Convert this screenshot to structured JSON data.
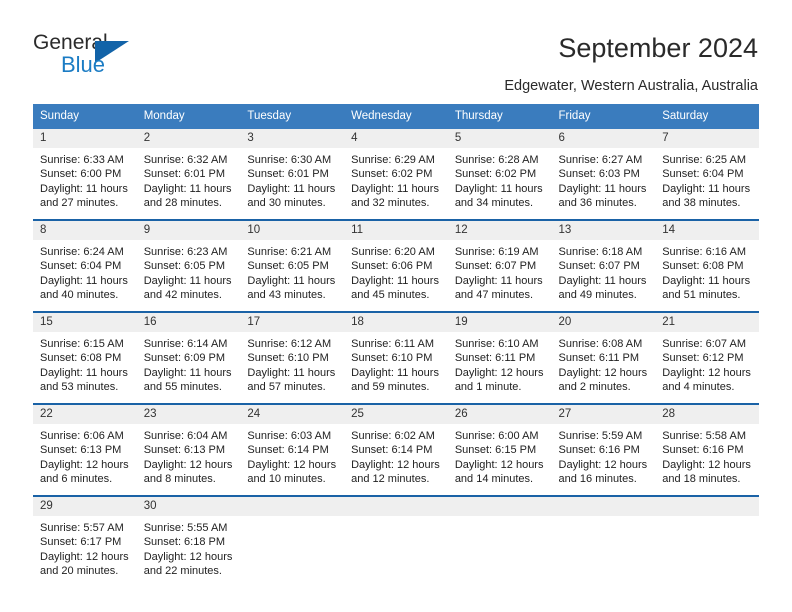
{
  "brand": {
    "name_top": "General",
    "name_bottom": "Blue",
    "accent_color": "#1b7cc4",
    "triangle_color": "#1263a8"
  },
  "header": {
    "title": "September 2024",
    "subtitle": "Edgewater, Western Australia, Australia"
  },
  "calendar": {
    "header_bg": "#3a7cbe",
    "row_divider_color": "#1a62a6",
    "daynum_bg": "#efefef",
    "weekdays": [
      "Sunday",
      "Monday",
      "Tuesday",
      "Wednesday",
      "Thursday",
      "Friday",
      "Saturday"
    ],
    "weeks": [
      [
        {
          "day": "1",
          "sunrise": "Sunrise: 6:33 AM",
          "sunset": "Sunset: 6:00 PM",
          "daylight": "Daylight: 11 hours and 27 minutes."
        },
        {
          "day": "2",
          "sunrise": "Sunrise: 6:32 AM",
          "sunset": "Sunset: 6:01 PM",
          "daylight": "Daylight: 11 hours and 28 minutes."
        },
        {
          "day": "3",
          "sunrise": "Sunrise: 6:30 AM",
          "sunset": "Sunset: 6:01 PM",
          "daylight": "Daylight: 11 hours and 30 minutes."
        },
        {
          "day": "4",
          "sunrise": "Sunrise: 6:29 AM",
          "sunset": "Sunset: 6:02 PM",
          "daylight": "Daylight: 11 hours and 32 minutes."
        },
        {
          "day": "5",
          "sunrise": "Sunrise: 6:28 AM",
          "sunset": "Sunset: 6:02 PM",
          "daylight": "Daylight: 11 hours and 34 minutes."
        },
        {
          "day": "6",
          "sunrise": "Sunrise: 6:27 AM",
          "sunset": "Sunset: 6:03 PM",
          "daylight": "Daylight: 11 hours and 36 minutes."
        },
        {
          "day": "7",
          "sunrise": "Sunrise: 6:25 AM",
          "sunset": "Sunset: 6:04 PM",
          "daylight": "Daylight: 11 hours and 38 minutes."
        }
      ],
      [
        {
          "day": "8",
          "sunrise": "Sunrise: 6:24 AM",
          "sunset": "Sunset: 6:04 PM",
          "daylight": "Daylight: 11 hours and 40 minutes."
        },
        {
          "day": "9",
          "sunrise": "Sunrise: 6:23 AM",
          "sunset": "Sunset: 6:05 PM",
          "daylight": "Daylight: 11 hours and 42 minutes."
        },
        {
          "day": "10",
          "sunrise": "Sunrise: 6:21 AM",
          "sunset": "Sunset: 6:05 PM",
          "daylight": "Daylight: 11 hours and 43 minutes."
        },
        {
          "day": "11",
          "sunrise": "Sunrise: 6:20 AM",
          "sunset": "Sunset: 6:06 PM",
          "daylight": "Daylight: 11 hours and 45 minutes."
        },
        {
          "day": "12",
          "sunrise": "Sunrise: 6:19 AM",
          "sunset": "Sunset: 6:07 PM",
          "daylight": "Daylight: 11 hours and 47 minutes."
        },
        {
          "day": "13",
          "sunrise": "Sunrise: 6:18 AM",
          "sunset": "Sunset: 6:07 PM",
          "daylight": "Daylight: 11 hours and 49 minutes."
        },
        {
          "day": "14",
          "sunrise": "Sunrise: 6:16 AM",
          "sunset": "Sunset: 6:08 PM",
          "daylight": "Daylight: 11 hours and 51 minutes."
        }
      ],
      [
        {
          "day": "15",
          "sunrise": "Sunrise: 6:15 AM",
          "sunset": "Sunset: 6:08 PM",
          "daylight": "Daylight: 11 hours and 53 minutes."
        },
        {
          "day": "16",
          "sunrise": "Sunrise: 6:14 AM",
          "sunset": "Sunset: 6:09 PM",
          "daylight": "Daylight: 11 hours and 55 minutes."
        },
        {
          "day": "17",
          "sunrise": "Sunrise: 6:12 AM",
          "sunset": "Sunset: 6:10 PM",
          "daylight": "Daylight: 11 hours and 57 minutes."
        },
        {
          "day": "18",
          "sunrise": "Sunrise: 6:11 AM",
          "sunset": "Sunset: 6:10 PM",
          "daylight": "Daylight: 11 hours and 59 minutes."
        },
        {
          "day": "19",
          "sunrise": "Sunrise: 6:10 AM",
          "sunset": "Sunset: 6:11 PM",
          "daylight": "Daylight: 12 hours and 1 minute."
        },
        {
          "day": "20",
          "sunrise": "Sunrise: 6:08 AM",
          "sunset": "Sunset: 6:11 PM",
          "daylight": "Daylight: 12 hours and 2 minutes."
        },
        {
          "day": "21",
          "sunrise": "Sunrise: 6:07 AM",
          "sunset": "Sunset: 6:12 PM",
          "daylight": "Daylight: 12 hours and 4 minutes."
        }
      ],
      [
        {
          "day": "22",
          "sunrise": "Sunrise: 6:06 AM",
          "sunset": "Sunset: 6:13 PM",
          "daylight": "Daylight: 12 hours and 6 minutes."
        },
        {
          "day": "23",
          "sunrise": "Sunrise: 6:04 AM",
          "sunset": "Sunset: 6:13 PM",
          "daylight": "Daylight: 12 hours and 8 minutes."
        },
        {
          "day": "24",
          "sunrise": "Sunrise: 6:03 AM",
          "sunset": "Sunset: 6:14 PM",
          "daylight": "Daylight: 12 hours and 10 minutes."
        },
        {
          "day": "25",
          "sunrise": "Sunrise: 6:02 AM",
          "sunset": "Sunset: 6:14 PM",
          "daylight": "Daylight: 12 hours and 12 minutes."
        },
        {
          "day": "26",
          "sunrise": "Sunrise: 6:00 AM",
          "sunset": "Sunset: 6:15 PM",
          "daylight": "Daylight: 12 hours and 14 minutes."
        },
        {
          "day": "27",
          "sunrise": "Sunrise: 5:59 AM",
          "sunset": "Sunset: 6:16 PM",
          "daylight": "Daylight: 12 hours and 16 minutes."
        },
        {
          "day": "28",
          "sunrise": "Sunrise: 5:58 AM",
          "sunset": "Sunset: 6:16 PM",
          "daylight": "Daylight: 12 hours and 18 minutes."
        }
      ],
      [
        {
          "day": "29",
          "sunrise": "Sunrise: 5:57 AM",
          "sunset": "Sunset: 6:17 PM",
          "daylight": "Daylight: 12 hours and 20 minutes."
        },
        {
          "day": "30",
          "sunrise": "Sunrise: 5:55 AM",
          "sunset": "Sunset: 6:18 PM",
          "daylight": "Daylight: 12 hours and 22 minutes."
        },
        {
          "day": "",
          "sunrise": "",
          "sunset": "",
          "daylight": ""
        },
        {
          "day": "",
          "sunrise": "",
          "sunset": "",
          "daylight": ""
        },
        {
          "day": "",
          "sunrise": "",
          "sunset": "",
          "daylight": ""
        },
        {
          "day": "",
          "sunrise": "",
          "sunset": "",
          "daylight": ""
        },
        {
          "day": "",
          "sunrise": "",
          "sunset": "",
          "daylight": ""
        }
      ]
    ]
  }
}
